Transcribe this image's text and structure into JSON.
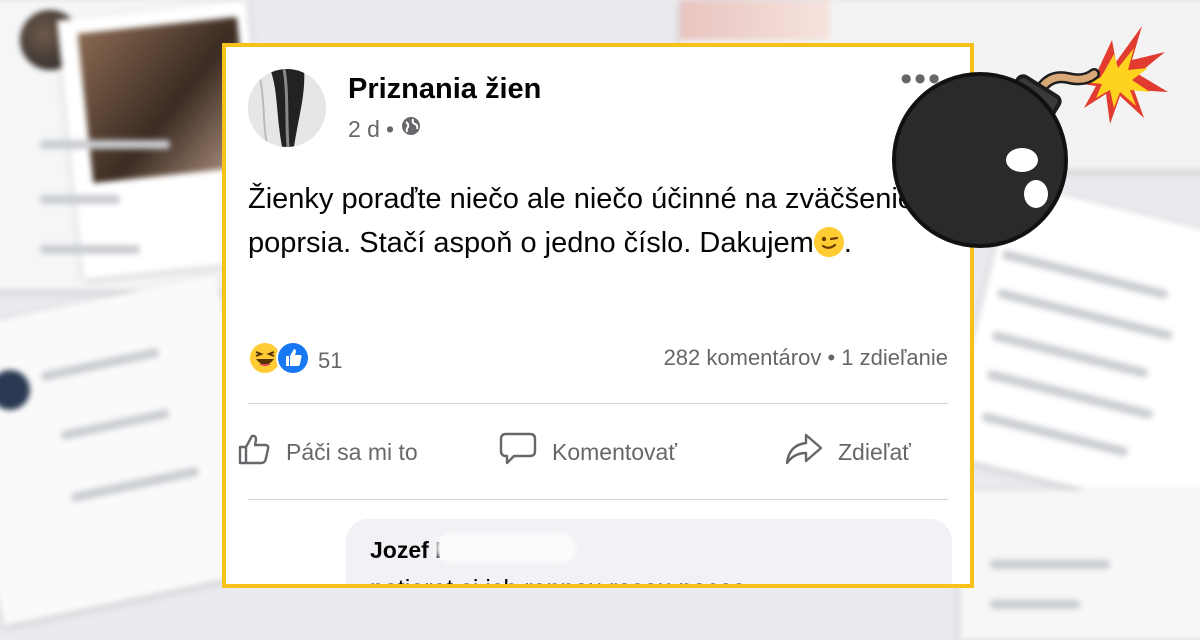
{
  "post": {
    "page_name": "Priznania žien",
    "time": "2 d",
    "separator": "•",
    "text": "Žienky poraďte niečo ale niečo účinné na zväčšenie poprsia. Stačí aspoň o jedno číslo. Dakujem",
    "text_end": ".",
    "reaction_count": "51",
    "comments_count": "282 komentárov",
    "stats_separator": "•",
    "shares_count": "1 zdieľanie"
  },
  "actions": {
    "like": "Páči sa mi to",
    "comment": "Komentovať",
    "share": "Zdieľať"
  },
  "comment": {
    "author": "Jozef Ko",
    "text": "potierat si ich rannou rosou pocas"
  },
  "colors": {
    "frame": "#f6c21a",
    "secondary_text": "#65676b",
    "like_blue": "#1877f2",
    "haha_yellow": "#ffcc33",
    "bomb": "#1d1d1f",
    "spark": "#ffd21f"
  },
  "icons": [
    "globe-icon",
    "more-icon",
    "haha-reaction-icon",
    "like-reaction-icon",
    "thumbs-up-icon",
    "comment-bubble-icon",
    "share-arrow-icon",
    "wink-emoji-icon",
    "bomb-icon"
  ]
}
